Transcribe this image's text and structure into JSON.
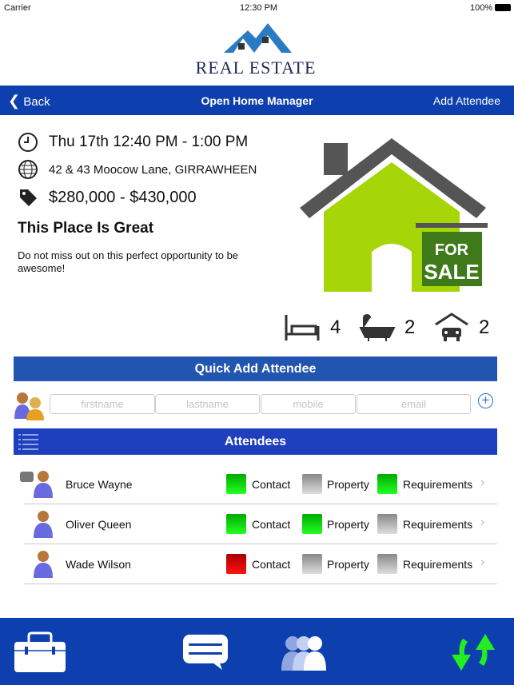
{
  "status": {
    "carrier": "Carrier",
    "time": "12:30 PM",
    "battery": "100%"
  },
  "logo": {
    "text": "REAL ESTATE"
  },
  "nav": {
    "back": "Back",
    "title": "Open Home Manager",
    "action": "Add Attendee"
  },
  "listing": {
    "time": "Thu 17th 12:40 PM - 1:00 PM",
    "address": "42 & 43 Moocow Lane, GIRRAWHEEN",
    "price": "$280,000 - $430,000",
    "headline": "This Place Is Great",
    "description": "Do not miss out on this perfect opportunity to be awesome!",
    "sign": "FOR SALE",
    "bedrooms": "4",
    "bathrooms": "2",
    "garage": "2"
  },
  "quick_add": {
    "title": "Quick Add Attendee",
    "placeholders": {
      "firstname": "firstname",
      "lastname": "lastname",
      "mobile": "mobile",
      "email": "email"
    }
  },
  "attendees": {
    "title": "Attendees",
    "labels": {
      "contact": "Contact",
      "property": "Property",
      "requirements": "Requirements"
    },
    "rows": [
      {
        "name": "Bruce Wayne",
        "note": true,
        "contact": "green",
        "property": "gray",
        "requirements": "green"
      },
      {
        "name": "Oliver Queen",
        "note": false,
        "contact": "green",
        "property": "green",
        "requirements": "gray"
      },
      {
        "name": "Wade Wilson",
        "note": false,
        "contact": "red",
        "property": "gray",
        "requirements": "gray"
      }
    ]
  },
  "colors": {
    "nav": "#0d3fae",
    "quick_add_header": "#2255b0",
    "attendees_header": "#1e3fbe",
    "house_green": "#a6d608",
    "sync_green": "#22ee22"
  },
  "tabbar": {
    "icons": [
      "toolbox-icon",
      "chat-icon",
      "group-icon",
      "sync-icon"
    ]
  }
}
